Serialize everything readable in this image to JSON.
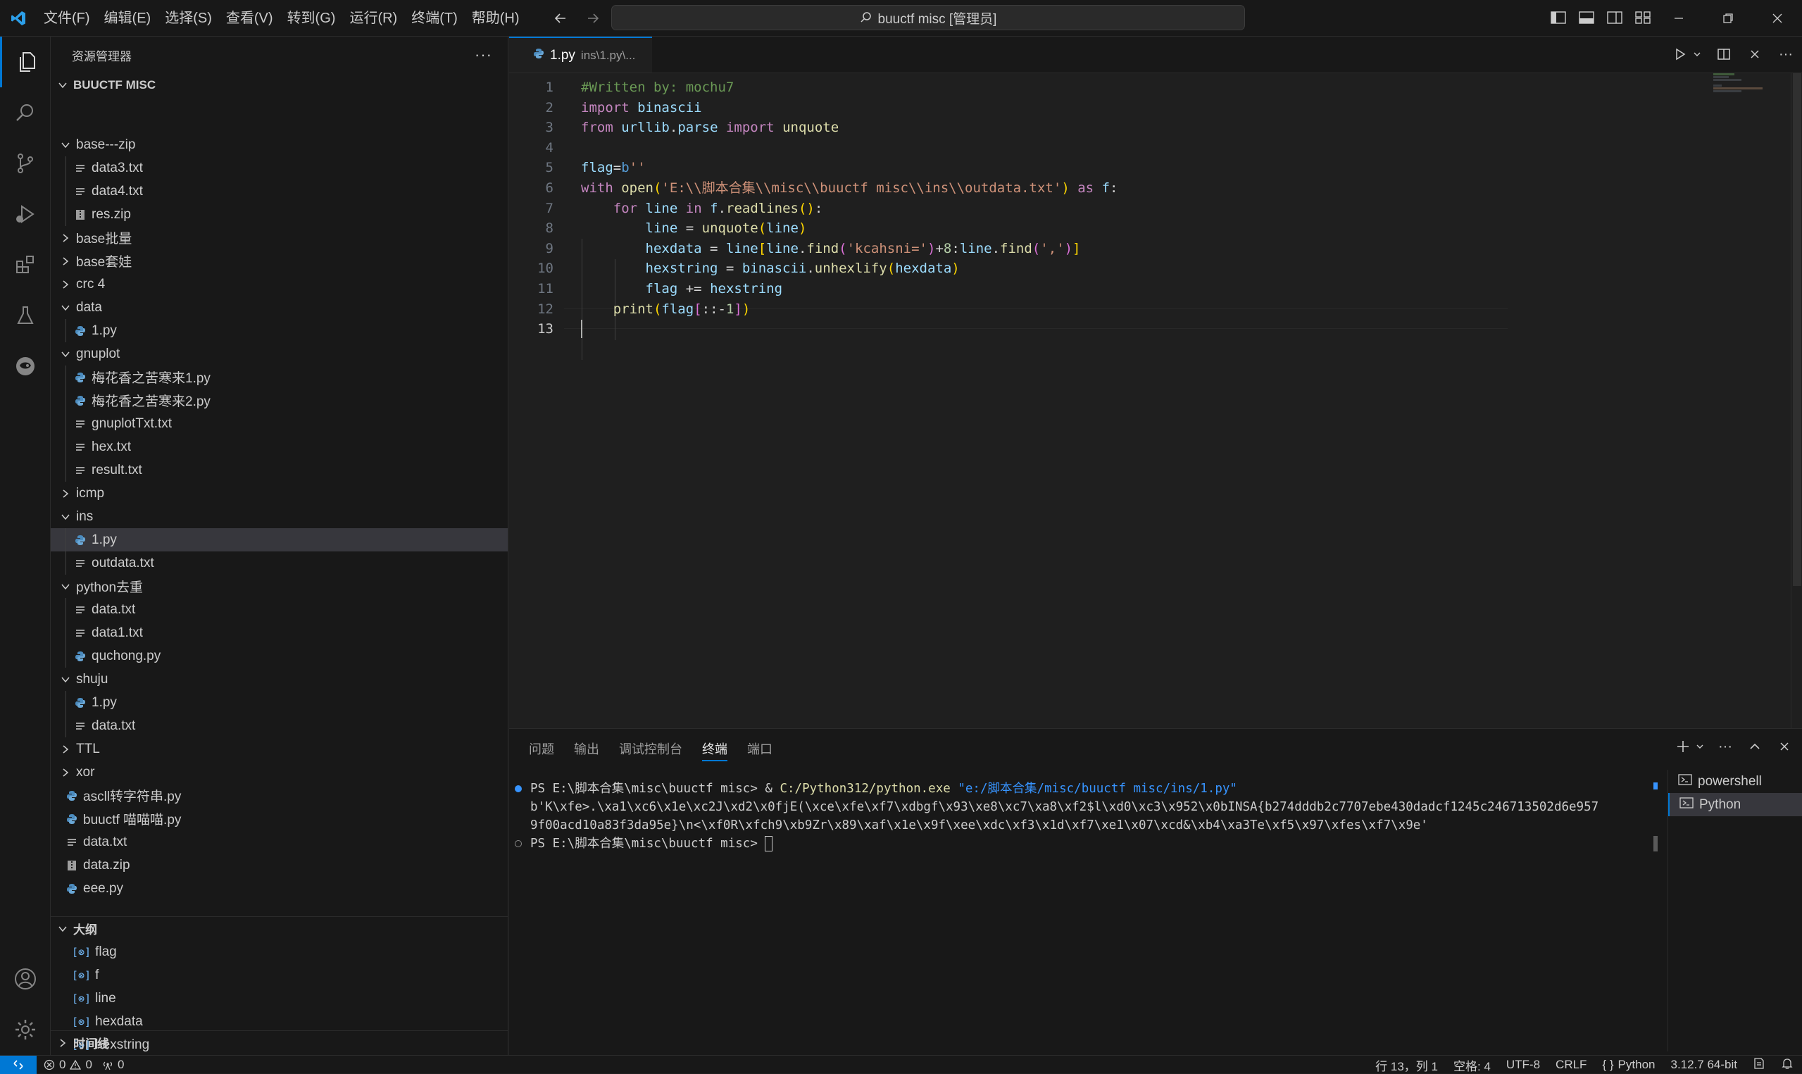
{
  "titlebar": {
    "menus": [
      "文件(F)",
      "编辑(E)",
      "选择(S)",
      "查看(V)",
      "转到(G)",
      "运行(R)",
      "终端(T)",
      "帮助(H)"
    ],
    "search_text": "buuctf misc [管理员]"
  },
  "sidebar": {
    "title": "资源管理器",
    "root": "BUUCTF MISC",
    "tree": [
      {
        "label": "base---zip",
        "type": "folder",
        "open": true,
        "depth": 1
      },
      {
        "label": "data3.txt",
        "type": "txt",
        "depth": 2
      },
      {
        "label": "data4.txt",
        "type": "txt",
        "depth": 2
      },
      {
        "label": "res.zip",
        "type": "zip",
        "depth": 2
      },
      {
        "label": "base批量",
        "type": "folder",
        "open": false,
        "depth": 1
      },
      {
        "label": "base套娃",
        "type": "folder",
        "open": false,
        "depth": 1
      },
      {
        "label": "crc 4",
        "type": "folder",
        "open": false,
        "depth": 1
      },
      {
        "label": "data",
        "type": "folder",
        "open": true,
        "depth": 1
      },
      {
        "label": "1.py",
        "type": "py",
        "depth": 2
      },
      {
        "label": "gnuplot",
        "type": "folder",
        "open": true,
        "depth": 1
      },
      {
        "label": "梅花香之苦寒来1.py",
        "type": "py",
        "depth": 2
      },
      {
        "label": "梅花香之苦寒来2.py",
        "type": "py",
        "depth": 2
      },
      {
        "label": "gnuplotTxt.txt",
        "type": "txt",
        "depth": 2
      },
      {
        "label": "hex.txt",
        "type": "txt",
        "depth": 2
      },
      {
        "label": "result.txt",
        "type": "txt",
        "depth": 2
      },
      {
        "label": "icmp",
        "type": "folder",
        "open": false,
        "depth": 1
      },
      {
        "label": "ins",
        "type": "folder",
        "open": true,
        "depth": 1
      },
      {
        "label": "1.py",
        "type": "py",
        "depth": 2,
        "selected": true
      },
      {
        "label": "outdata.txt",
        "type": "txt",
        "depth": 2
      },
      {
        "label": "python去重",
        "type": "folder",
        "open": true,
        "depth": 1
      },
      {
        "label": "data.txt",
        "type": "txt",
        "depth": 2
      },
      {
        "label": "data1.txt",
        "type": "txt",
        "depth": 2
      },
      {
        "label": "quchong.py",
        "type": "py",
        "depth": 2
      },
      {
        "label": "shuju",
        "type": "folder",
        "open": true,
        "depth": 1
      },
      {
        "label": "1.py",
        "type": "py",
        "depth": 2
      },
      {
        "label": "data.txt",
        "type": "txt",
        "depth": 2
      },
      {
        "label": "TTL",
        "type": "folder",
        "open": false,
        "depth": 1
      },
      {
        "label": "xor",
        "type": "folder",
        "open": false,
        "depth": 1
      },
      {
        "label": "ascll转字符串.py",
        "type": "py",
        "depth": 1
      },
      {
        "label": "buuctf 喵喵喵.py",
        "type": "py",
        "depth": 1
      },
      {
        "label": "data.txt",
        "type": "txt",
        "depth": 1
      },
      {
        "label": "data.zip",
        "type": "zip",
        "depth": 1
      },
      {
        "label": "eee.py",
        "type": "py",
        "depth": 1
      }
    ],
    "outline_title": "大纲",
    "outline": [
      "flag",
      "f",
      "line",
      "hexdata",
      "hexstring"
    ],
    "timeline_title": "时间线"
  },
  "editor": {
    "tab_name": "1.py",
    "tab_desc": "ins\\1.py\\...",
    "line_numbers": [
      "1",
      "2",
      "3",
      "4",
      "5",
      "6",
      "7",
      "8",
      "9",
      "10",
      "11",
      "12",
      "13"
    ]
  },
  "panel": {
    "tabs": [
      "问题",
      "输出",
      "调试控制台",
      "终端",
      "端口"
    ],
    "active_tab": "终端",
    "terminal": {
      "prompt1": "PS E:\\脚本合集\\misc\\buuctf misc> & ",
      "exe": "C:/Python312/python.exe",
      "script": " \"e:/脚本合集/misc/buuctf misc/ins/1.py\"",
      "out1": "b'K\\xfe>.\\xa1\\xc6\\x1e\\xc2J\\xd2\\x0fjE(\\xce\\xfe\\xf7\\xdbgf\\x93\\xe8\\xc7\\xa8\\xf2$l\\xd0\\xc3\\x952\\x0bINSA{b274dddb2c7707ebe430dadcf1245c246713502d6e957",
      "out2": "9f00acd10a83f3da95e}\\n<\\xf0R\\xfch9\\xb9Zr\\x89\\xaf\\x1e\\x9f\\xee\\xdc\\xf3\\x1d\\xf7\\xe1\\x07\\xcd&\\xb4\\xa3Te\\xf5\\x97\\xfes\\xf7\\x9e'",
      "prompt2": "PS E:\\脚本合集\\misc\\buuctf misc> "
    },
    "terminals": [
      "powershell",
      "Python"
    ]
  },
  "statusbar": {
    "errors": "0",
    "warnings": "0",
    "ports": "0",
    "position": "行 13，列 1",
    "spaces": "空格: 4",
    "encoding": "UTF-8",
    "eol": "CRLF",
    "language": "Python",
    "interpreter": "3.12.7 64-bit"
  },
  "colors": {
    "accent": "#0078d4",
    "background": "#1f1f1f",
    "sidebar": "#181818"
  }
}
